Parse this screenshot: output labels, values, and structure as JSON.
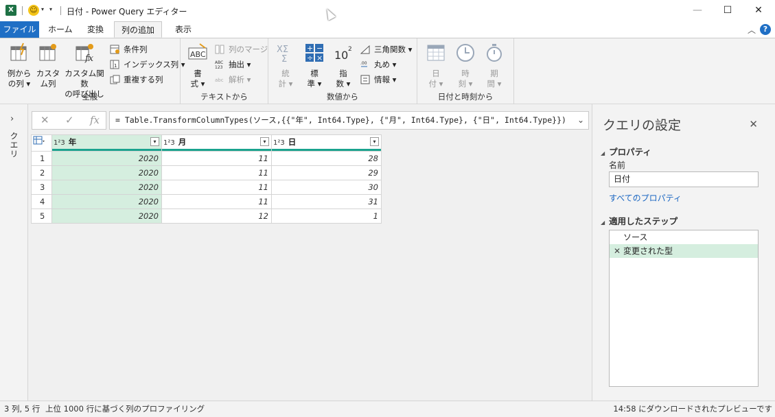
{
  "window": {
    "title": "日付 - Power Query エディター",
    "app_icon_letter": "X",
    "min": "—",
    "max": "☐",
    "close": "✕"
  },
  "tabs": {
    "file": "ファイル",
    "home": "ホーム",
    "transform": "変換",
    "add_column": "列の追加",
    "view": "表示",
    "help": "?",
    "collapse": "︿"
  },
  "ribbon": {
    "general": {
      "label": "全般",
      "column_from_examples": [
        "例から",
        "の列 ▾"
      ],
      "custom_column": [
        "カスタ",
        "ム列"
      ],
      "invoke_custom_function": [
        "カスタム関数",
        "の呼び出し"
      ],
      "conditional_column": "条件列",
      "index_column": "インデックス列 ▾",
      "duplicate_column": "重複する列"
    },
    "text": {
      "label": "テキストから",
      "format": [
        "書",
        "式 ▾"
      ],
      "merge_columns": "列のマージ",
      "extract": "抽出 ▾",
      "parse": "解析 ▾"
    },
    "number": {
      "label": "数値から",
      "statistics": [
        "統",
        "計 ▾"
      ],
      "standard": [
        "標",
        "準 ▾"
      ],
      "scientific": [
        "指",
        "数 ▾"
      ],
      "trigonometry": "三角関数 ▾",
      "rounding": "丸め ▾",
      "information": "情報 ▾"
    },
    "datetime": {
      "label": "日付と時刻から",
      "date": [
        "日",
        "付 ▾"
      ],
      "time": [
        "時",
        "刻 ▾"
      ],
      "duration": [
        "期",
        "間 ▾"
      ]
    }
  },
  "queries_pane": {
    "label": "クエリ",
    "expand": "›"
  },
  "formula": {
    "text": "= Table.TransformColumnTypes(ソース,{{\"年\", Int64.Type}, {\"月\", Int64.Type}, {\"日\", Int64.Type}})",
    "cancel": "✕",
    "commit": "✓",
    "fx": "fx",
    "expand": "⌄"
  },
  "table": {
    "type_label": "1²3",
    "columns": [
      "年",
      "月",
      "日"
    ],
    "rows": [
      [
        "1",
        "2020",
        "11",
        "28"
      ],
      [
        "2",
        "2020",
        "11",
        "29"
      ],
      [
        "3",
        "2020",
        "11",
        "30"
      ],
      [
        "4",
        "2020",
        "11",
        "31"
      ],
      [
        "5",
        "2020",
        "12",
        "1"
      ]
    ]
  },
  "settings": {
    "title": "クエリの設定",
    "close": "✕",
    "properties": "プロパティ",
    "name_label": "名前",
    "name_value": "日付",
    "all_properties": "すべてのプロパティ",
    "applied_steps": "適用したステップ",
    "steps": [
      {
        "label": "ソース",
        "active": false
      },
      {
        "label": "変更された型",
        "active": true
      }
    ]
  },
  "status": {
    "counts": "3 列, 5 行",
    "profiling": "上位 1000 行に基づく列のプロファイリング",
    "preview": "14:58 にダウンロードされたプレビューです"
  },
  "colors": {
    "accent": "#1f6fc5",
    "selected_column": "#d5eedf",
    "quality_bar": "#1aa38e"
  }
}
